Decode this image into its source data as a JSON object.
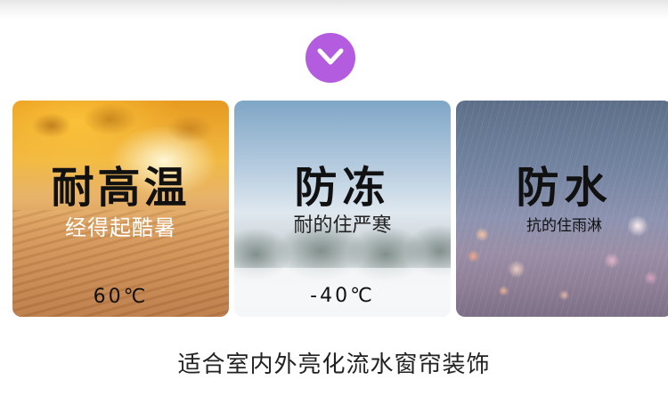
{
  "colors": {
    "chevron_bg": "#b35ce0",
    "title_text": "#111111",
    "caption_text": "#222222"
  },
  "chevron": {
    "icon": "chevron-down-icon"
  },
  "cards": [
    {
      "title": "耐高温",
      "subtitle": "经得起酷暑",
      "temp": "60℃"
    },
    {
      "title": "防冻",
      "subtitle": "耐的住严寒",
      "temp": "-40℃"
    },
    {
      "title": "防水",
      "subtitle": "抗的住雨淋"
    }
  ],
  "caption": "适合室内外亮化流水窗帘装饰"
}
